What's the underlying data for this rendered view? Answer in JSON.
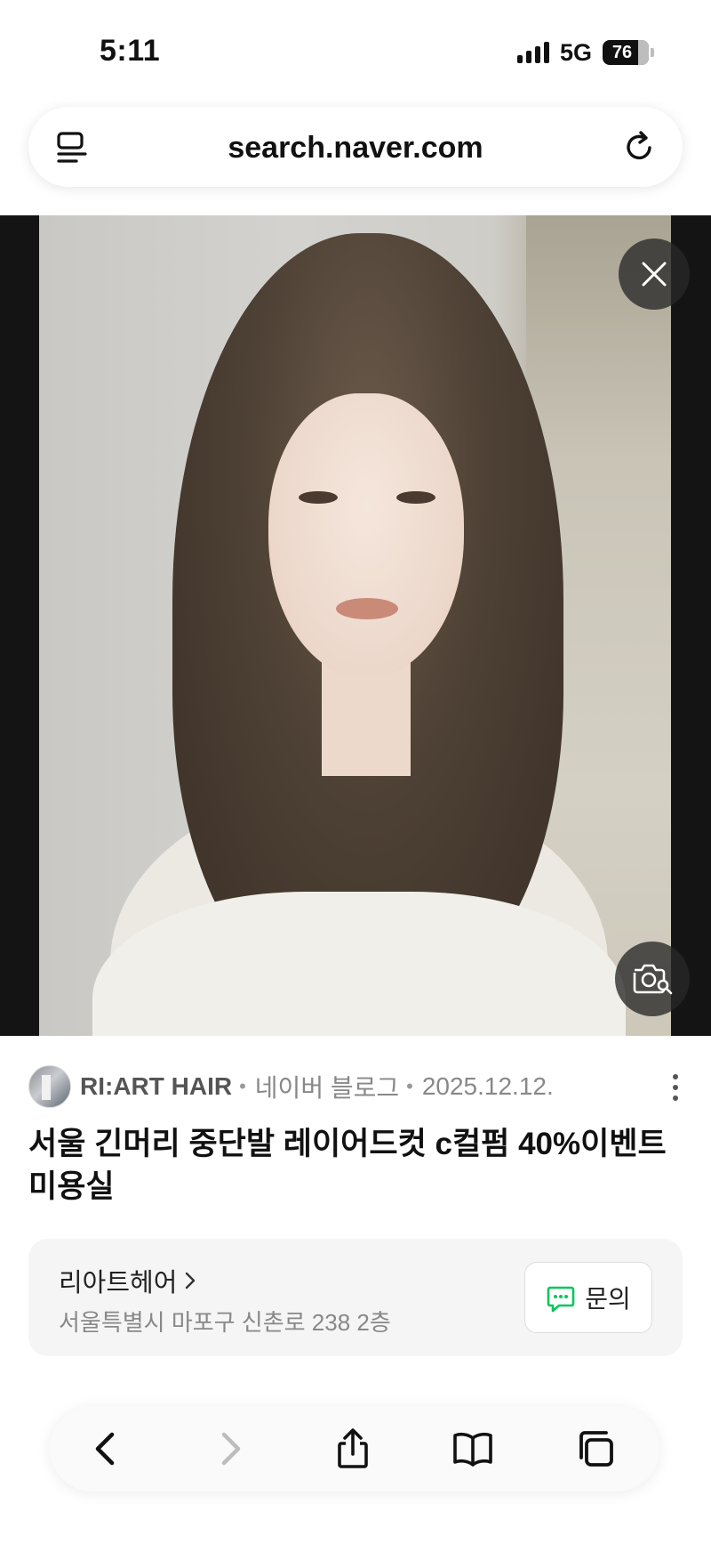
{
  "status_bar": {
    "time": "5:11",
    "network": "5G",
    "battery": "76"
  },
  "browser": {
    "url": "search.naver.com"
  },
  "image_viewer": {
    "icons": [
      "close-icon",
      "lens-search-icon"
    ]
  },
  "source": {
    "name": "RI:ART HAIR",
    "platform": "네이버 블로그",
    "date": "2025.12.12."
  },
  "headline": "서울 긴머리 중단발 레이어드컷 c컬펌 40%이벤트 미용실",
  "place": {
    "name": "리아트헤어",
    "address": "서울특별시 마포구 신촌로 238 2층",
    "inquiry_label": "문의",
    "accent": "#03c75a"
  },
  "toolbar": {
    "icons": [
      "back-icon",
      "forward-icon",
      "share-icon",
      "bookmarks-icon",
      "tabs-icon"
    ]
  }
}
